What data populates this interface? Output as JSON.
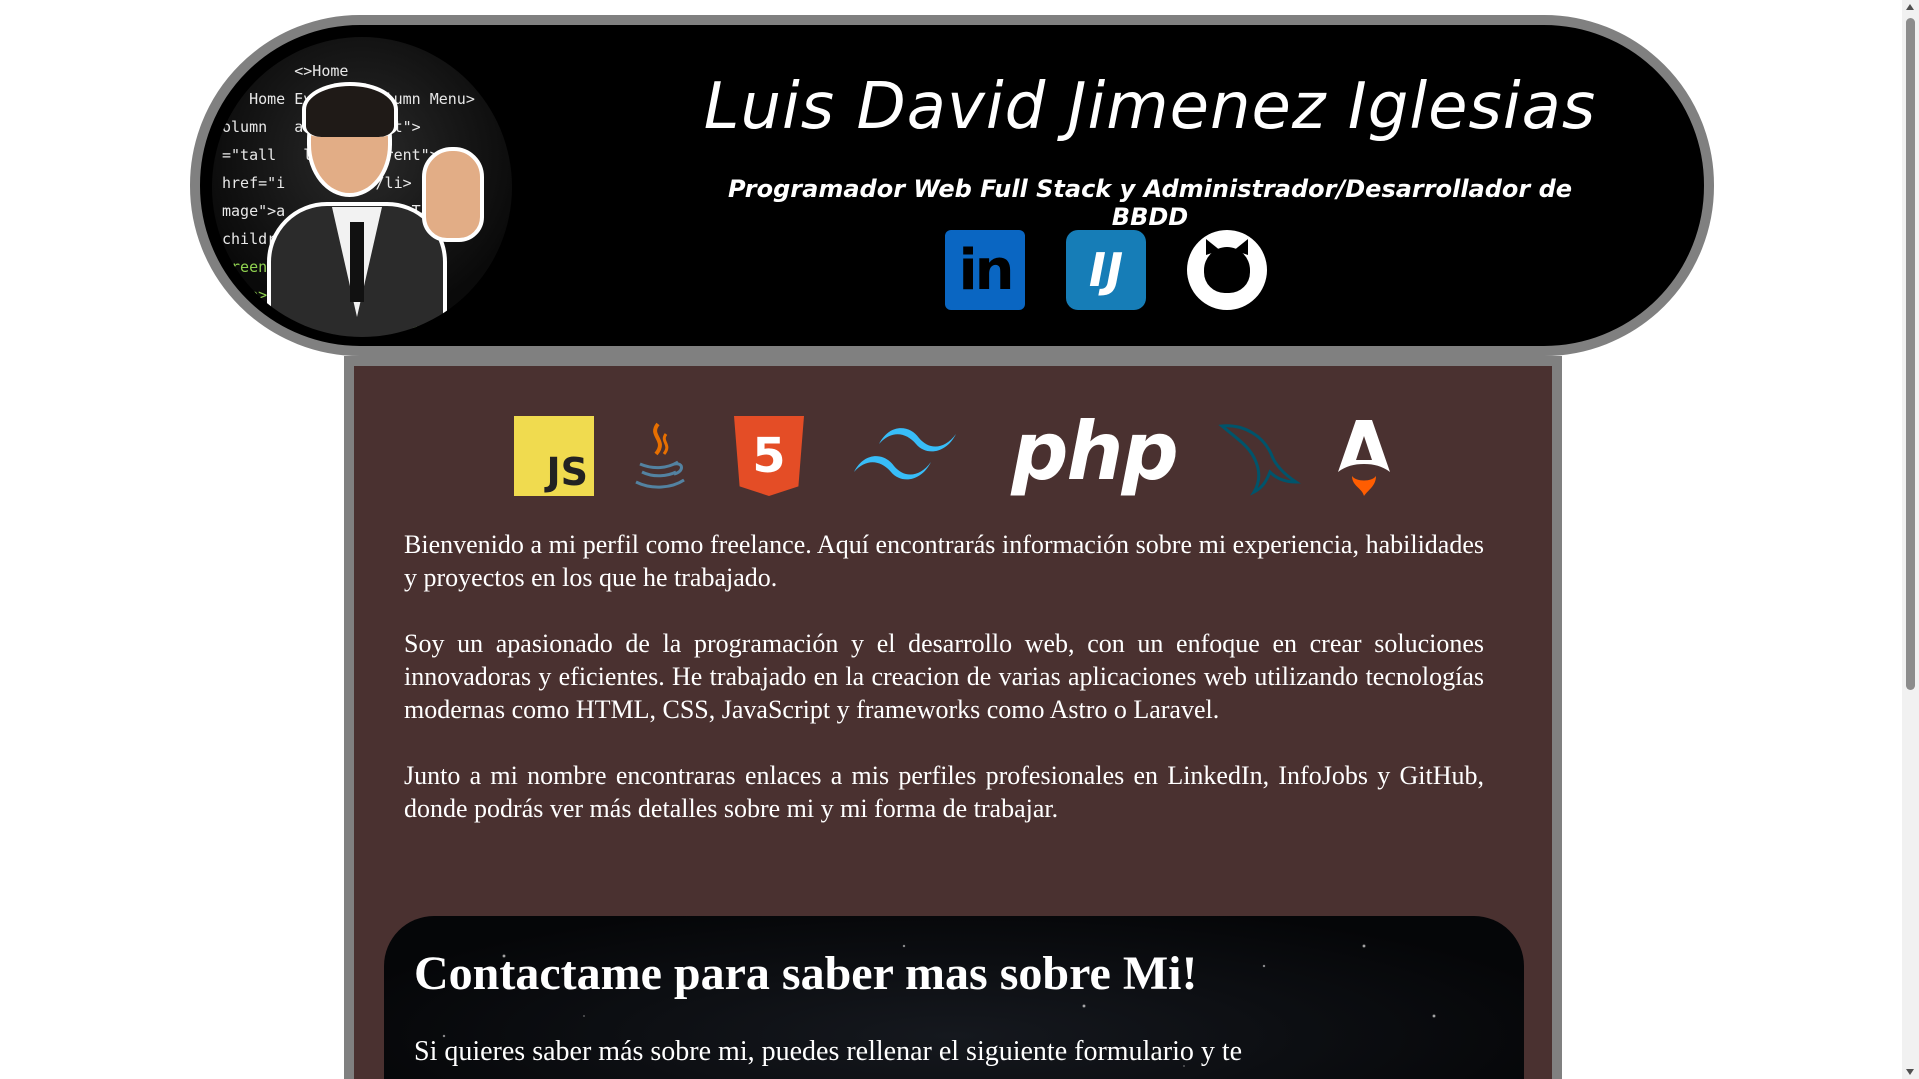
{
  "header": {
    "name": "Luis David Jimenez Iglesias",
    "subtitle": "Programador Web Full Stack y Administrador/Desarrollador de BBDD",
    "avatar_icon": "developer-avatar",
    "social": [
      {
        "name": "LinkedIn",
        "icon": "linkedin-icon",
        "glyph": "in",
        "color": "#0a66c2"
      },
      {
        "name": "InfoJobs",
        "icon": "infojobs-icon",
        "glyph": "IJ",
        "color": "#167db7"
      },
      {
        "name": "GitHub",
        "icon": "github-icon",
        "color": "#ffffff"
      }
    ]
  },
  "technologies": [
    {
      "name": "JavaScript",
      "icon": "javascript-icon",
      "glyph": "JS",
      "color": "#f0db4f"
    },
    {
      "name": "Java",
      "icon": "java-icon",
      "color": "#e76f00"
    },
    {
      "name": "HTML5",
      "icon": "html5-icon",
      "glyph": "5",
      "color": "#e44d26"
    },
    {
      "name": "Tailwind CSS",
      "icon": "tailwind-icon",
      "color": "#38bdf8"
    },
    {
      "name": "PHP",
      "icon": "php-icon",
      "glyph": "php",
      "color": "#ffffff"
    },
    {
      "name": "MySQL",
      "icon": "mysql-icon",
      "color": "#00546b"
    },
    {
      "name": "Astro",
      "icon": "astro-icon",
      "color": "#ffffff"
    }
  ],
  "intro": {
    "p1": "Bienvenido a mi perfil como freelance. Aquí encontrarás información sobre mi experiencia, habilidades y proyectos en los que he trabajado.",
    "p2": "Soy un apasionado de la programación y el desarrollo web, con un enfoque en crear soluciones innovadoras y eficientes. He trabajado en la creacion de varias aplicaciones web utilizando tecnologías modernas como HTML, CSS, JavaScript y frameworks como Astro o Laravel.",
    "p3": "Junto a mi nombre encontraras enlaces a mis perfiles profesionales en LinkedIn, InfoJobs y GitHub, donde podrás ver más detalles sobre mi y mi forma de trabajar."
  },
  "contact": {
    "title": "Contactame para saber mas sobre Mi!",
    "text": "Si quieres saber más sobre mi, puedes rellenar el siguiente formulario y te"
  },
  "colors": {
    "header_bg": "#000000",
    "border": "#808080",
    "main_bg": "#4a3130"
  }
}
